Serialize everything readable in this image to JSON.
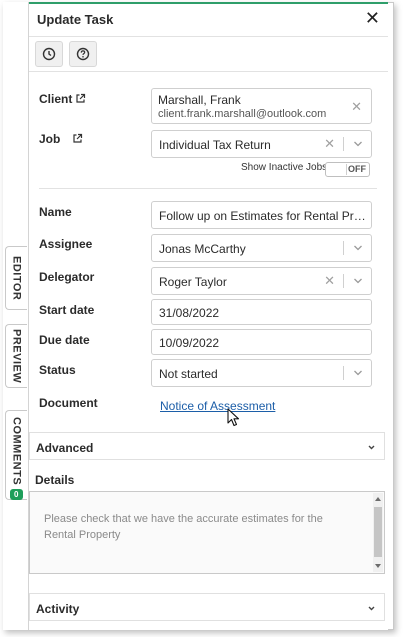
{
  "header": {
    "title": "Update Task",
    "close_icon": "close-icon"
  },
  "toolbar": {
    "history_icon": "clock-icon",
    "help_icon": "help-icon"
  },
  "side_tabs": {
    "editor": "EDITOR",
    "preview": "PREVIEW",
    "comments": "COMMENTS",
    "comments_count": "0"
  },
  "form": {
    "client": {
      "label": "Client",
      "name": "Marshall, Frank",
      "email": "client.frank.marshall@outlook.com"
    },
    "job": {
      "label": "Job",
      "value": "Individual Tax Return"
    },
    "show_inactive": {
      "label": "Show Inactive Jobs",
      "state": "OFF"
    },
    "name": {
      "label": "Name",
      "value": "Follow up on Estimates for Rental Prop..."
    },
    "assignee": {
      "label": "Assignee",
      "value": "Jonas McCarthy"
    },
    "delegator": {
      "label": "Delegator",
      "value": "Roger Taylor"
    },
    "start_date": {
      "label": "Start date",
      "value": "31/08/2022"
    },
    "due_date": {
      "label": "Due date",
      "value": "10/09/2022"
    },
    "status": {
      "label": "Status",
      "value": "Not started"
    },
    "document": {
      "label": "Document",
      "link": "Notice of Assessment"
    }
  },
  "sections": {
    "advanced": "Advanced",
    "details_title": "Details",
    "details_text": "Please check that we have the accurate estimates for the Rental Property",
    "activity": "Activity"
  },
  "colors": {
    "accent": "#2e9e6a",
    "link": "#1c5ea8",
    "badge": "#1e9e5a"
  }
}
